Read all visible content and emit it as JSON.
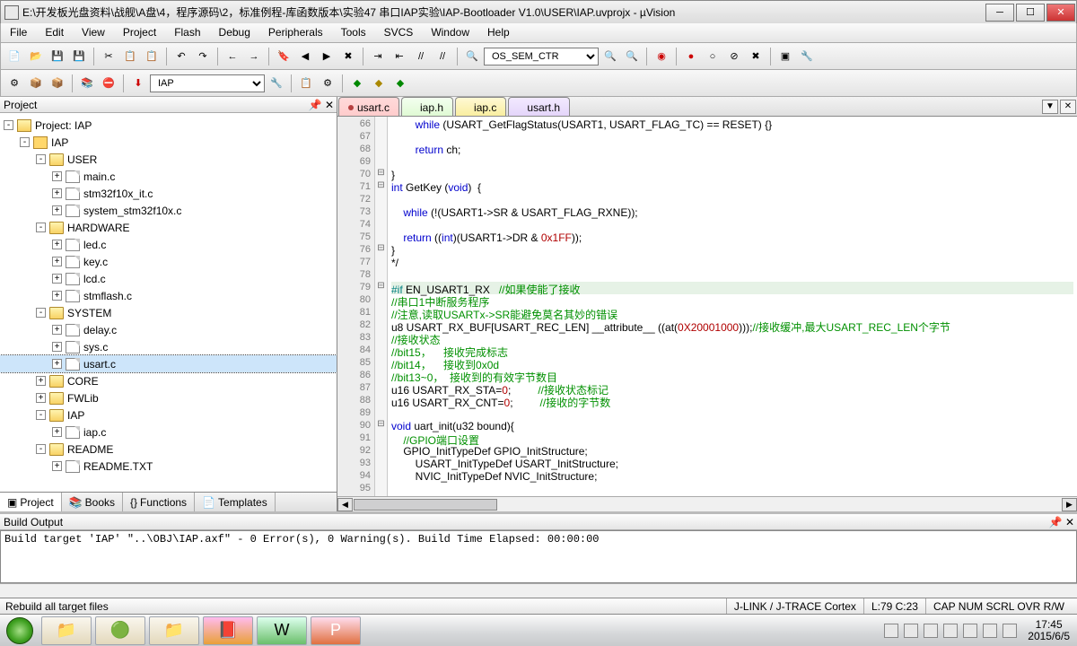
{
  "title": "E:\\开发板光盘资料\\战舰\\A盘\\4，程序源码\\2，标准例程-库函数版本\\实验47 串口IAP实验\\IAP-Bootloader V1.0\\USER\\IAP.uvprojx - µVision",
  "menu": [
    "File",
    "Edit",
    "View",
    "Project",
    "Flash",
    "Debug",
    "Peripherals",
    "Tools",
    "SVCS",
    "Window",
    "Help"
  ],
  "find_value": "OS_SEM_CTR",
  "target_value": "IAP",
  "panels": {
    "project": "Project",
    "build": "Build Output"
  },
  "project_tree": {
    "root": "Project: IAP",
    "cfg": "IAP",
    "groups": [
      {
        "name": "USER",
        "files": [
          "main.c",
          "stm32f10x_it.c",
          "system_stm32f10x.c"
        ]
      },
      {
        "name": "HARDWARE",
        "files": [
          "led.c",
          "key.c",
          "lcd.c",
          "stmflash.c"
        ]
      },
      {
        "name": "SYSTEM",
        "files": [
          "delay.c",
          "sys.c",
          "usart.c"
        ]
      },
      {
        "name": "CORE",
        "files": []
      },
      {
        "name": "FWLib",
        "files": []
      },
      {
        "name": "IAP",
        "files": [
          "iap.c"
        ]
      },
      {
        "name": "README",
        "files": [
          "README.TXT"
        ]
      }
    ],
    "selected": "usart.c"
  },
  "project_tabs": [
    "Project",
    "Books",
    "Functions",
    "Templates"
  ],
  "editor_tabs": [
    {
      "label": "usart.c",
      "cls": "et-usartc",
      "dirty": true
    },
    {
      "label": "iap.h",
      "cls": "et-iaph"
    },
    {
      "label": "iap.c",
      "cls": "et-iapc"
    },
    {
      "label": "usart.h",
      "cls": "et-usarth"
    }
  ],
  "line_start": 66,
  "line_end": 95,
  "code_lines": [
    {
      "n": 66,
      "h": "        <span class=\"kw\">while</span> (USART_GetFlagStatus(USART1, USART_FLAG_TC) == RESET) {}"
    },
    {
      "n": 67,
      "h": ""
    },
    {
      "n": 68,
      "h": "        <span class=\"kw\">return</span> ch;"
    },
    {
      "n": 69,
      "h": ""
    },
    {
      "n": 70,
      "h": "}"
    },
    {
      "n": 71,
      "h": "<span class=\"kw\">int</span> GetKey (<span class=\"kw\">void</span>)  {"
    },
    {
      "n": 72,
      "h": ""
    },
    {
      "n": 73,
      "h": "    <span class=\"kw\">while</span> (!(USART1-&gt;SR &amp; USART_FLAG_RXNE));"
    },
    {
      "n": 74,
      "h": ""
    },
    {
      "n": 75,
      "h": "    <span class=\"kw\">return</span> ((<span class=\"kw\">int</span>)(USART1-&gt;DR &amp; <span class=\"num\">0x1FF</span>));"
    },
    {
      "n": 76,
      "h": "}"
    },
    {
      "n": 77,
      "h": "*/"
    },
    {
      "n": 78,
      "h": ""
    },
    {
      "n": 79,
      "hl": true,
      "h": "<span class=\"pp\">#if</span> EN_USART1_RX   <span class=\"cm\">//如果使能了接收</span>"
    },
    {
      "n": 80,
      "h": "<span class=\"cm\">//串口1中断服务程序</span>"
    },
    {
      "n": 81,
      "h": "<span class=\"cm\">//注意,读取USARTx-&gt;SR能避免莫名其妙的错误</span>"
    },
    {
      "n": 82,
      "h": "u8 USART_RX_BUF[USART_REC_LEN] __attribute__ ((at(<span class=\"num\">0X20001000</span>)));<span class=\"cm\">//接收缓冲,最大USART_REC_LEN个字节</span>"
    },
    {
      "n": 83,
      "h": "<span class=\"cm\">//接收状态</span>"
    },
    {
      "n": 84,
      "h": "<span class=\"cm\">//bit15，    接收完成标志</span>"
    },
    {
      "n": 85,
      "h": "<span class=\"cm\">//bit14，    接收到0x0d</span>"
    },
    {
      "n": 86,
      "h": "<span class=\"cm\">//bit13~0，  接收到的有效字节数目</span>"
    },
    {
      "n": 87,
      "h": "u16 USART_RX_STA=<span class=\"num\">0</span>;         <span class=\"cm\">//接收状态标记</span>"
    },
    {
      "n": 88,
      "h": "u16 USART_RX_CNT=<span class=\"num\">0</span>;         <span class=\"cm\">//接收的字节数</span>"
    },
    {
      "n": 89,
      "h": ""
    },
    {
      "n": 90,
      "h": "<span class=\"kw\">void</span> uart_init(u32 bound){"
    },
    {
      "n": 91,
      "h": "    <span class=\"cm\">//GPIO端口设置</span>"
    },
    {
      "n": 92,
      "h": "    GPIO_InitTypeDef GPIO_InitStructure;"
    },
    {
      "n": 93,
      "h": "        USART_InitTypeDef USART_InitStructure;"
    },
    {
      "n": 94,
      "h": "        NVIC_InitTypeDef NVIC_InitStructure;"
    },
    {
      "n": 95,
      "h": ""
    }
  ],
  "build_output": [
    "Build target 'IAP'",
    "\"..\\OBJ\\IAP.axf\" - 0 Error(s), 0 Warning(s).",
    "Build Time Elapsed:  00:00:00"
  ],
  "status": {
    "hint": "Rebuild all target files",
    "debug": "J-LINK / J-TRACE Cortex",
    "pos": "L:79 C:23",
    "flags": "CAP  NUM  SCRL  OVR  R/W",
    "time": "17:45",
    "date": "2015/6/5"
  },
  "chart_data": null
}
